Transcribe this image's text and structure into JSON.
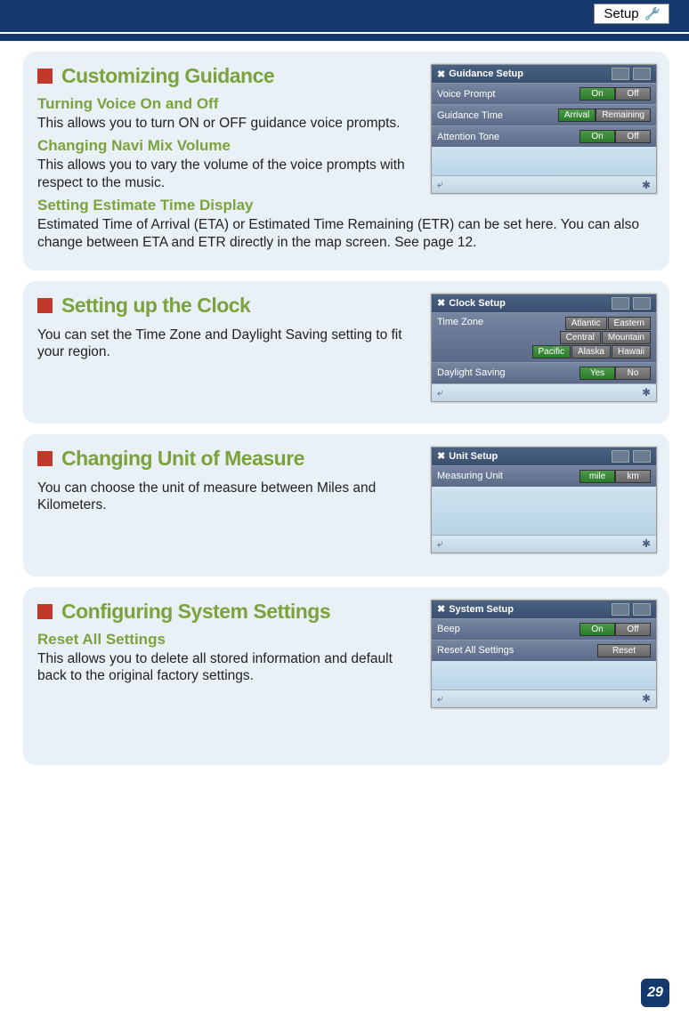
{
  "header": {
    "tab_label": "Setup"
  },
  "page_number": "29",
  "sections": [
    {
      "title": "Customizing Guidance",
      "screenshot": {
        "title": "Guidance Setup",
        "rows": [
          {
            "label": "Voice Prompt",
            "opts": [
              "On",
              "Off"
            ],
            "active": 0
          },
          {
            "label": "Guidance Time",
            "opts": [
              "Arrival",
              "Remaining"
            ],
            "active": 0
          },
          {
            "label": "Attention Tone",
            "opts": [
              "On",
              "Off"
            ],
            "active": 0
          }
        ]
      },
      "subs": [
        {
          "heading": "Turning Voice On and Off",
          "text": "This allows you to turn ON or OFF guidance voice prompts."
        },
        {
          "heading": "Changing Navi Mix Volume",
          "text": "This allows you to vary the volume of the voice prompts with respect to the music."
        },
        {
          "heading": "Setting Estimate Time Display",
          "text": "Estimated Time of Arrival (ETA) or Estimated Time Remaining (ETR) can be set here. You can also change between ETA and ETR directly in the map screen. See page 12.",
          "wide": true
        }
      ]
    },
    {
      "title": "Setting up the Clock",
      "screenshot": {
        "title": "Clock Setup",
        "tz_label": "Time Zone",
        "tz_opts": [
          [
            "Atlantic",
            "Eastern"
          ],
          [
            "Central",
            "Mountain"
          ],
          [
            "Pacific",
            "Alaska",
            "Hawaii"
          ]
        ],
        "tz_active": "Pacific",
        "ds": {
          "label": "Daylight Saving",
          "opts": [
            "Yes",
            "No"
          ],
          "active": 0
        }
      },
      "text": "You can set the Time Zone and Daylight Saving setting to fit your region."
    },
    {
      "title": "Changing Unit of Measure",
      "screenshot": {
        "title": "Unit Setup",
        "rows": [
          {
            "label": "Measuring Unit",
            "opts": [
              "mile",
              "km"
            ],
            "active": 0
          }
        ]
      },
      "text": "You can choose the unit of measure between Miles and Kilometers."
    },
    {
      "title": "Configuring System Settings",
      "screenshot": {
        "title": "System Setup",
        "rows": [
          {
            "label": "Beep",
            "opts": [
              "On",
              "Off"
            ],
            "active": 0
          },
          {
            "label": "Reset All Settings",
            "opts": [
              "Reset"
            ],
            "active": -1
          }
        ]
      },
      "subs": [
        {
          "heading": "Reset All Settings",
          "text": "This allows you to delete all stored information and default back to the original factory settings."
        }
      ]
    }
  ]
}
